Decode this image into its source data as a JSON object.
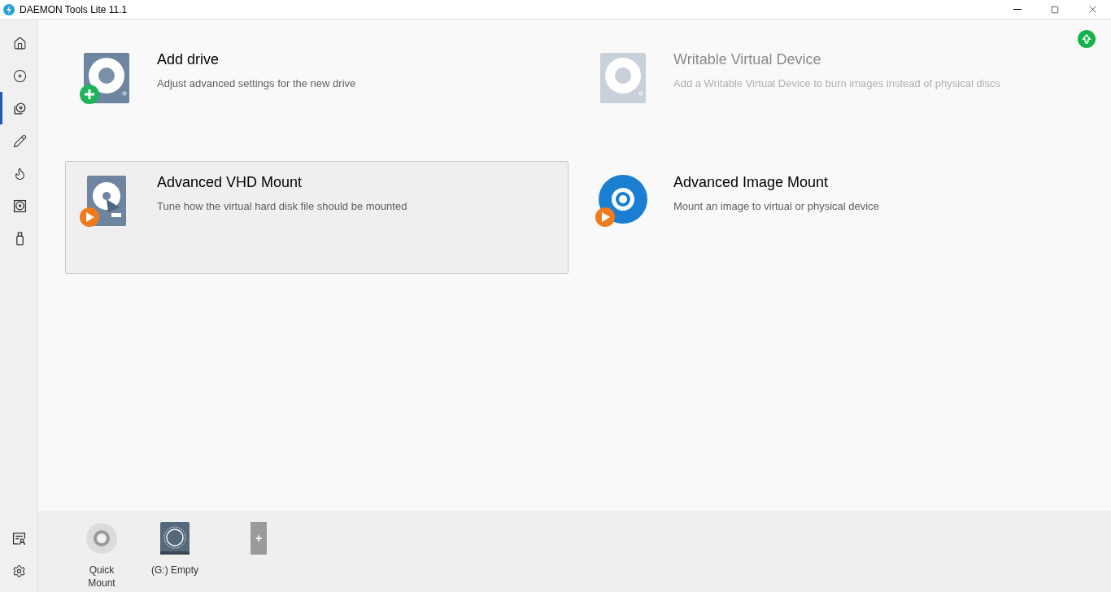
{
  "window": {
    "title": "DAEMON Tools Lite 11.1"
  },
  "sidebar": {
    "items": [
      {
        "kind": "home",
        "selected": false
      },
      {
        "kind": "disc",
        "selected": false
      },
      {
        "kind": "images",
        "selected": true
      },
      {
        "kind": "pencil",
        "selected": false
      },
      {
        "kind": "flame",
        "selected": false
      },
      {
        "kind": "drive",
        "selected": false
      },
      {
        "kind": "usb",
        "selected": false
      }
    ],
    "bottom_items": [
      {
        "kind": "license"
      },
      {
        "kind": "settings"
      }
    ]
  },
  "cards": [
    {
      "kind": "add",
      "title": "Add drive",
      "description": "Adjust advanced settings for the new drive",
      "disabled": false,
      "selected": false
    },
    {
      "kind": "writable",
      "title": "Writable Virtual Device",
      "description": "Add a Writable Virtual Device to burn images instead of physical discs",
      "disabled": true,
      "selected": false
    },
    {
      "kind": "vhd",
      "title": "Advanced VHD Mount",
      "description": "Tune how the virtual hard disk file should be mounted",
      "disabled": false,
      "selected": true
    },
    {
      "kind": "image",
      "title": "Advanced Image Mount",
      "description": "Mount an image to virtual or physical device",
      "disabled": false,
      "selected": false
    }
  ],
  "drives": [
    {
      "kind": "quick",
      "label": "Quick Mount"
    },
    {
      "kind": "drive",
      "label": "(G:) Empty"
    },
    {
      "kind": "add",
      "label": "+"
    }
  ]
}
